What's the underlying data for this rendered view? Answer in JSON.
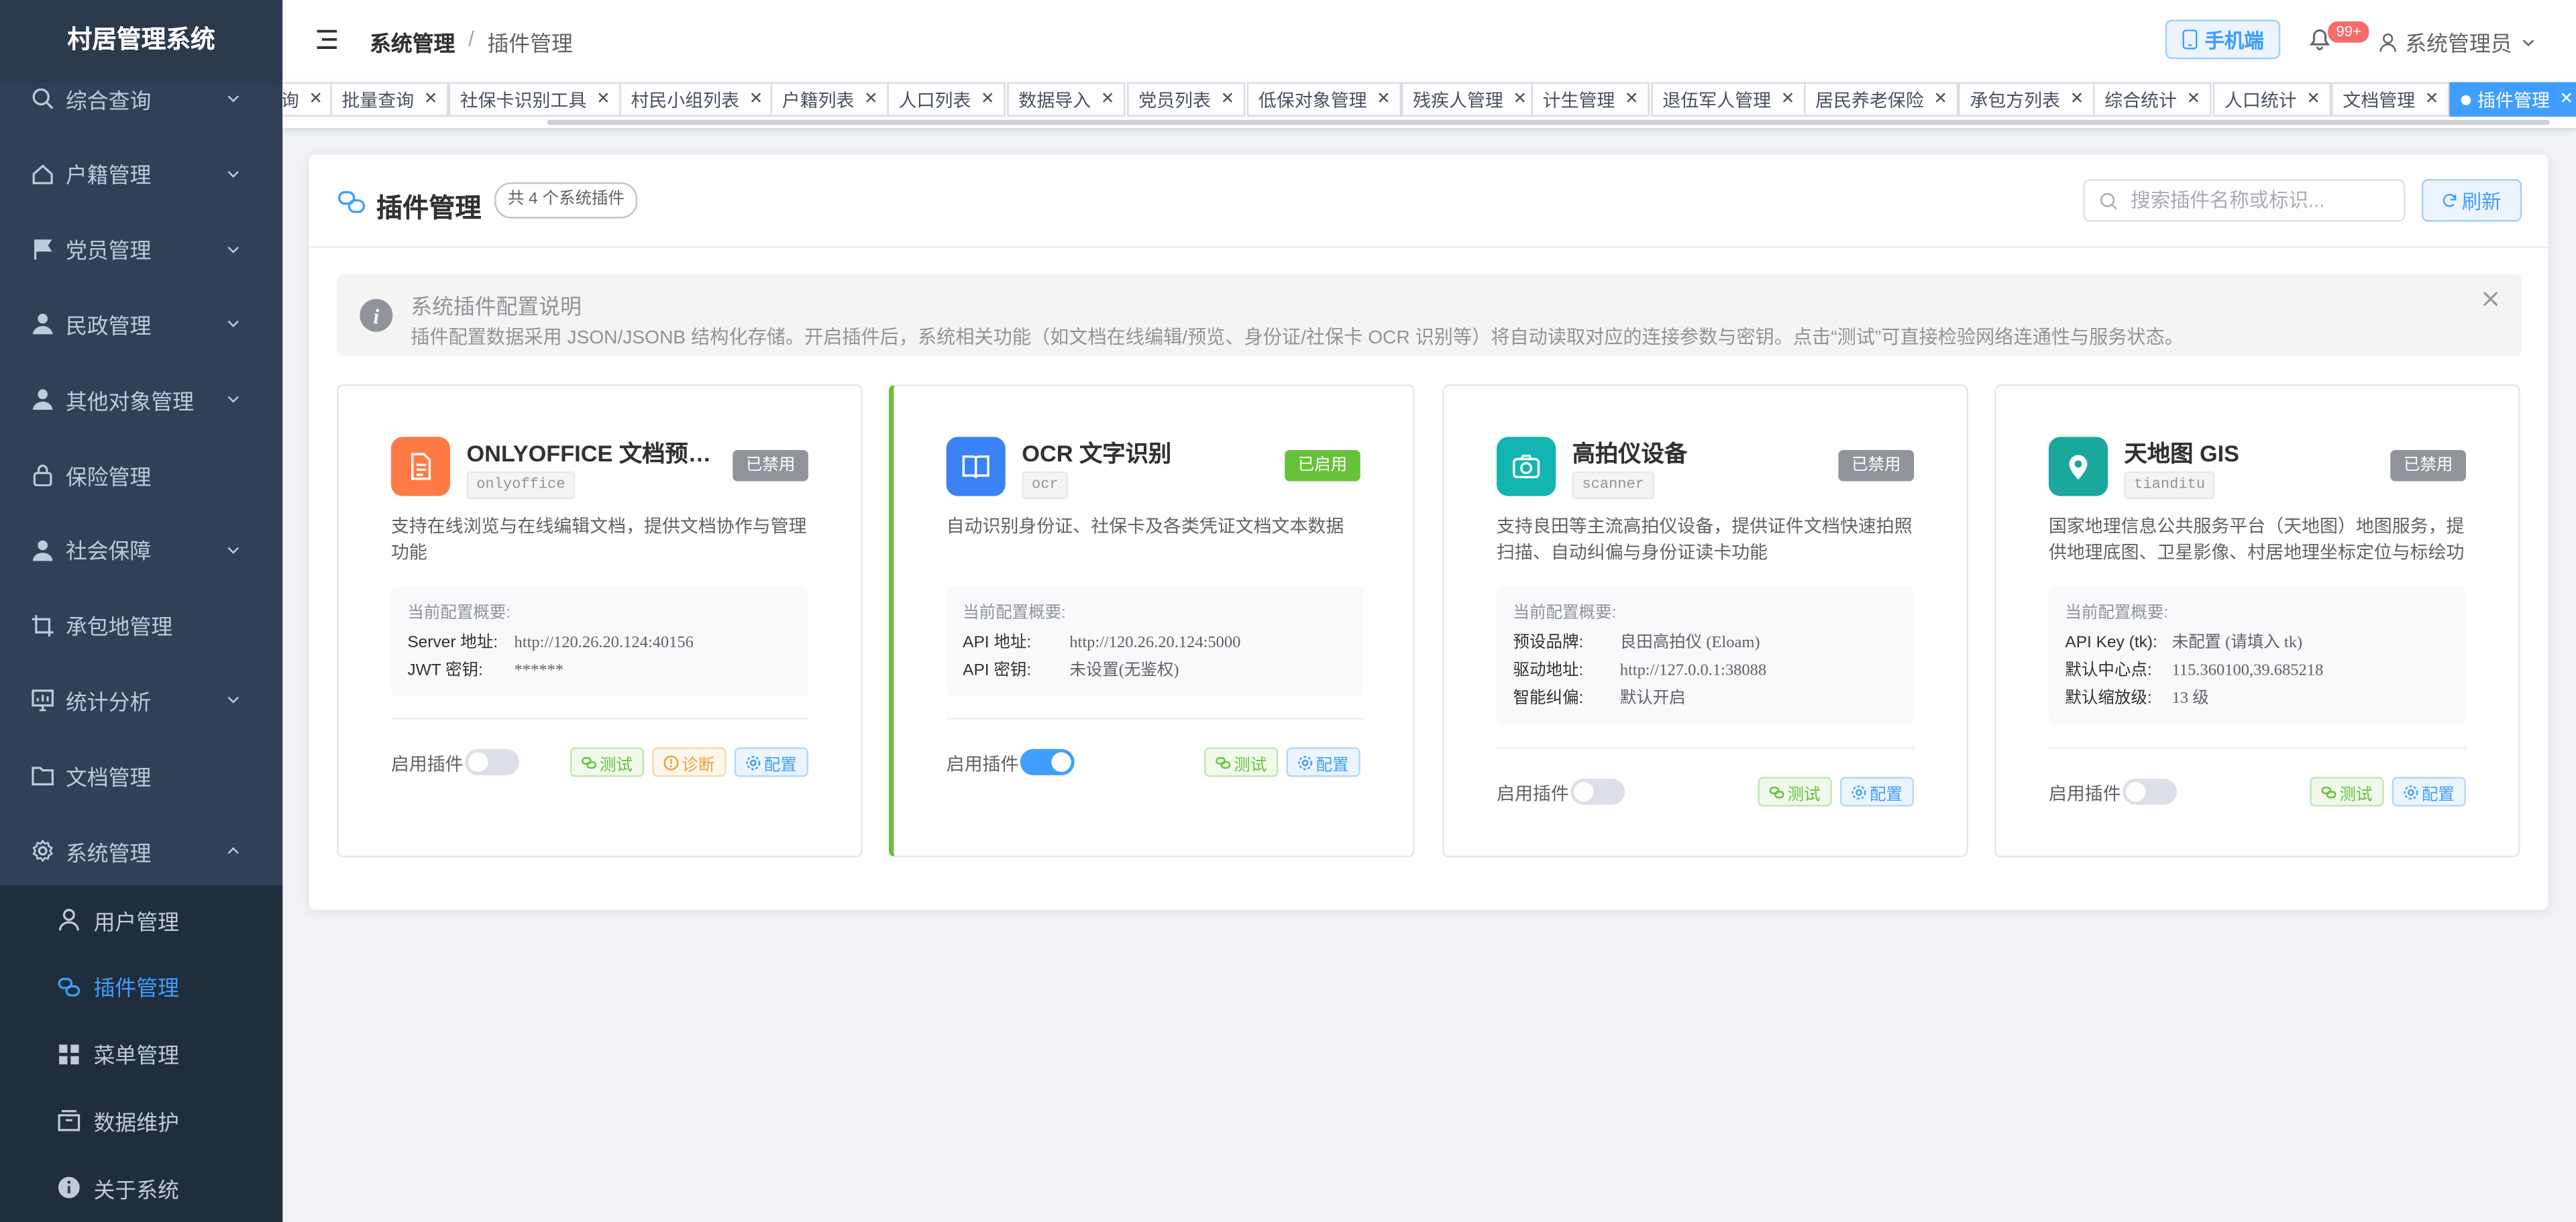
{
  "app": {
    "title": "村居管理系统"
  },
  "sidebar": {
    "items": [
      {
        "label": "综合查询",
        "icon": "search-icon",
        "chevron": true
      },
      {
        "label": "户籍管理",
        "icon": "home-icon",
        "chevron": true
      },
      {
        "label": "党员管理",
        "icon": "flag-icon",
        "chevron": true
      },
      {
        "label": "民政管理",
        "icon": "person-icon",
        "chevron": true
      },
      {
        "label": "其他对象管理",
        "icon": "person-icon",
        "chevron": true
      },
      {
        "label": "保险管理",
        "icon": "lock-icon",
        "chevron": false
      },
      {
        "label": "社会保障",
        "icon": "person-icon",
        "chevron": true
      },
      {
        "label": "承包地管理",
        "icon": "crop-icon",
        "chevron": false
      },
      {
        "label": "统计分析",
        "icon": "chart-icon",
        "chevron": true
      },
      {
        "label": "文档管理",
        "icon": "folder-icon",
        "chevron": false
      },
      {
        "label": "系统管理",
        "icon": "gear-icon",
        "chevron": true,
        "expanded": true
      }
    ],
    "subitems": [
      {
        "label": "用户管理",
        "icon": "user-icon"
      },
      {
        "label": "插件管理",
        "icon": "plugin-icon",
        "active": true
      },
      {
        "label": "菜单管理",
        "icon": "grid-icon"
      },
      {
        "label": "数据维护",
        "icon": "box-icon"
      },
      {
        "label": "关于系统",
        "icon": "info-icon"
      }
    ]
  },
  "navbar": {
    "breadcrumb": [
      "系统管理",
      "/",
      "插件管理"
    ],
    "mobile_label": "手机端",
    "badge": "99+",
    "user": "系统管理员"
  },
  "tags": [
    {
      "label": "询"
    },
    {
      "label": "批量查询"
    },
    {
      "label": "社保卡识别工具"
    },
    {
      "label": "村民小组列表"
    },
    {
      "label": "户籍列表"
    },
    {
      "label": "人口列表"
    },
    {
      "label": "数据导入"
    },
    {
      "label": "党员列表"
    },
    {
      "label": "低保对象管理"
    },
    {
      "label": "残疾人管理"
    },
    {
      "label": "计生管理"
    },
    {
      "label": "退伍军人管理"
    },
    {
      "label": "居民养老保险"
    },
    {
      "label": "承包方列表"
    },
    {
      "label": "综合统计"
    },
    {
      "label": "人口统计"
    },
    {
      "label": "文档管理"
    },
    {
      "label": "插件管理",
      "active": true
    }
  ],
  "main": {
    "title": "插件管理",
    "count": "共 4 个系统插件",
    "search_placeholder": "搜索插件名称或标识...",
    "refresh_label": "刷新",
    "alert_title": "系统插件配置说明",
    "alert_desc": "插件配置数据采用 JSON/JSONB 结构化存储。开启插件后，系统相关功能（如文档在线编辑/预览、身份证/社保卡 OCR 识别等）将自动读取对应的连接参数与密钥。点击“测试”可直接检验网络连通性与服务状态。"
  },
  "cards": [
    {
      "name": "ONLYOFFICE 文档预览与编辑",
      "code": "onlyoffice",
      "status": "已禁用",
      "enabled": false,
      "color": "#ff7a45",
      "icon": "document-icon",
      "desc": "支持在线浏览与在线编辑文档，提供文档协作与管理功能",
      "config_title": "当前配置概要:",
      "config": [
        {
          "k": "Server 地址:",
          "v": "http://120.26.20.124:40156"
        },
        {
          "k": "JWT 密钥:",
          "v": "******"
        }
      ],
      "toggle_label": "启用插件",
      "buttons": [
        {
          "label": "测试",
          "type": "test"
        },
        {
          "label": "诊断",
          "type": "diag"
        },
        {
          "label": "配置",
          "type": "conf"
        }
      ]
    },
    {
      "name": "OCR 文字识别",
      "code": "ocr",
      "status": "已启用",
      "enabled": true,
      "color": "#3b82f6",
      "icon": "book-icon",
      "desc": "自动识别身份证、社保卡及各类凭证文档文本数据",
      "config_title": "当前配置概要:",
      "config": [
        {
          "k": "API 地址:",
          "v": "http://120.26.20.124:5000"
        },
        {
          "k": "API 密钥:",
          "v": "未设置(无鉴权)"
        }
      ],
      "toggle_label": "启用插件",
      "buttons": [
        {
          "label": "测试",
          "type": "test"
        },
        {
          "label": "配置",
          "type": "conf"
        }
      ]
    },
    {
      "name": "高拍仪设备",
      "code": "scanner",
      "status": "已禁用",
      "enabled": false,
      "color": "#13b5b1",
      "icon": "camera-icon",
      "desc": "支持良田等主流高拍仪设备，提供证件文档快速拍照扫描、自动纠偏与身份证读卡功能",
      "config_title": "当前配置概要:",
      "config": [
        {
          "k": "预设品牌:",
          "v": "良田高拍仪 (Eloam)"
        },
        {
          "k": "驱动地址:",
          "v": "http://127.0.0.1:38088"
        },
        {
          "k": "智能纠偏:",
          "v": "默认开启"
        }
      ],
      "toggle_label": "启用插件",
      "buttons": [
        {
          "label": "测试",
          "type": "test"
        },
        {
          "label": "配置",
          "type": "conf"
        }
      ]
    },
    {
      "name": "天地图 GIS",
      "code": "tianditu",
      "status": "已禁用",
      "enabled": false,
      "color": "#1aa89c",
      "icon": "map-pin-icon",
      "desc": "国家地理信息公共服务平台（天地图）地图服务，提供地理底图、卫星影像、村居地理坐标定位与标绘功能",
      "config_title": "当前配置概要:",
      "config": [
        {
          "k": "API Key (tk):",
          "v": "未配置 (请填入 tk)"
        },
        {
          "k": "默认中心点:",
          "v": "115.360100,39.685218"
        },
        {
          "k": "默认缩放级:",
          "v": "13 级"
        }
      ],
      "toggle_label": "启用插件",
      "buttons": [
        {
          "label": "测试",
          "type": "test"
        },
        {
          "label": "配置",
          "type": "conf"
        }
      ]
    }
  ]
}
